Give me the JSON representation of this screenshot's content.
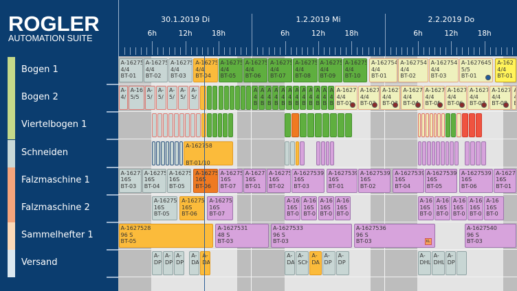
{
  "logo": {
    "name": "ROGLER",
    "subtitle": "AUTOMATION SUITE"
  },
  "timeline": {
    "days": [
      {
        "key": "30.1",
        "label": "30.1.2019 Di"
      },
      {
        "key": "1.2",
        "label": "1.2.2019 Mi"
      },
      {
        "key": "2.2",
        "label": "2.2.2019 Do"
      }
    ],
    "hour_labels": [
      {
        "h": 6,
        "label": "6h"
      },
      {
        "h": 12,
        "label": "12h"
      },
      {
        "h": 18,
        "label": "18h"
      }
    ],
    "current_time": "30.1 15:30"
  },
  "colors": {
    "grey": [
      "#c8d6d4",
      "#8fa3a3"
    ],
    "greyred": [
      "#c8d6d4",
      "#e07a72"
    ],
    "greyblue": [
      "#c8d6d4",
      "#2e5580"
    ],
    "orange": [
      "#fbbb3b",
      "#e39a1d"
    ],
    "dkorange": [
      "#ef7a22",
      "#c85a10"
    ],
    "green": [
      "#5faf3f",
      "#43902c"
    ],
    "ly": [
      "#eef1bd",
      "#e6a87c"
    ],
    "lyred": [
      "#f0edb8",
      "#e06f5f"
    ],
    "yellow": [
      "#fff45a",
      "#c9a21a"
    ],
    "purple": [
      "#d7a3dc",
      "#9d73ad"
    ],
    "red": [
      "#ef5340",
      "#d53a2a"
    ],
    "night": "#bdbdbd",
    "day": "#e4e4e4",
    "now_line": "#2b5d96"
  },
  "rows": [
    {
      "label": "Bogen 1",
      "stripe": "#c5d98a",
      "bars": [
        {
          "s": "30.1 0:00",
          "e": "30.1 4:30",
          "c": "grey",
          "t": [
            "A-16275",
            "4/4",
            "BT-01"
          ]
        },
        {
          "s": "30.1 4:30",
          "e": "30.1 9:00",
          "c": "grey",
          "t": [
            "A-16275",
            "4/4",
            "BT-02"
          ]
        },
        {
          "s": "30.1 9:00",
          "e": "30.1 13:30",
          "c": "grey",
          "t": [
            "A-16275",
            "4/4",
            "BT-03"
          ]
        },
        {
          "s": "30.1 13:30",
          "e": "30.1 18:00",
          "c": "orange",
          "t": [
            "A-16275",
            "4/4",
            "BT-04"
          ]
        },
        {
          "s": "30.1 18:00",
          "e": "30.1 22:30",
          "c": "green",
          "t": [
            "A-16275",
            "4/4",
            "BT-05"
          ]
        },
        {
          "s": "30.1 22:30",
          "e": "1.2 3:00",
          "c": "green",
          "t": [
            "A-16275",
            "4/4",
            "BT-06"
          ]
        },
        {
          "s": "1.2 3:00",
          "e": "1.2 7:30",
          "c": "green",
          "t": [
            "A-16275",
            "4/4",
            "BT-07"
          ]
        },
        {
          "s": "1.2 7:30",
          "e": "1.2 12:00",
          "c": "green",
          "t": [
            "A-16275",
            "4/4",
            "BT-08"
          ]
        },
        {
          "s": "1.2 12:00",
          "e": "1.2 16:30",
          "c": "green",
          "t": [
            "A-16275",
            "4/4",
            "BT-09"
          ]
        },
        {
          "s": "1.2 16:30",
          "e": "1.2 21:00",
          "c": "green",
          "t": [
            "A-16275",
            "4/4",
            "BT-10"
          ]
        },
        {
          "s": "1.2 21:15",
          "e": "2.2 2:30",
          "c": "ly",
          "t": [
            "A-1627541",
            "4/4",
            "BT-01"
          ]
        },
        {
          "s": "2.2 2:30",
          "e": "2.2 8:00",
          "c": "ly",
          "t": [
            "A-1627541",
            "4/4",
            "BT-02"
          ]
        },
        {
          "s": "2.2 8:00",
          "e": "2.2 13:30",
          "c": "ly",
          "t": [
            "A-1627541",
            "4/4",
            "BT-03"
          ]
        },
        {
          "s": "2.2 13:30",
          "e": "2.2 19:45",
          "c": "ly",
          "t": [
            "A-1627645",
            "5/5",
            "BT-01"
          ],
          "dot": "#1f5a9a"
        },
        {
          "s": "2.2 20:00",
          "e": "2.2 24:00",
          "c": "yellow",
          "t": [
            "A-162",
            "4/4",
            "BT-01"
          ]
        }
      ]
    },
    {
      "label": "Bogen 2",
      "stripe": "#c5d98a",
      "bars": [
        {
          "s": "30.1 0:00",
          "e": "30.1 1:45",
          "c": "greyred",
          "t": [
            "A-",
            "4/"
          ]
        },
        {
          "s": "30.1 1:45",
          "e": "30.1 4:45",
          "c": "greyred",
          "t": [
            "A-16",
            "5/5"
          ]
        },
        {
          "s": "30.1 4:45",
          "e": "30.1 6:45",
          "c": "greyred",
          "t": [
            "A-",
            "5/"
          ]
        },
        {
          "s": "30.1 6:45",
          "e": "30.1 8:45",
          "c": "greyred",
          "t": [
            "A-",
            "5/"
          ]
        },
        {
          "s": "30.1 8:45",
          "e": "30.1 10:45",
          "c": "greyred",
          "t": [
            "A-",
            "5/"
          ]
        },
        {
          "s": "30.1 10:45",
          "e": "30.1 12:45",
          "c": "greyred",
          "t": [
            "A-",
            "5/"
          ]
        },
        {
          "s": "30.1 12:45",
          "e": "30.1 14:45",
          "c": "greyred",
          "t": [
            "A-",
            "5/"
          ]
        },
        {
          "s": "30.1 14:45",
          "e": "30.1 16:00",
          "c": "orange",
          "n": 1
        },
        {
          "s": "30.1 16:00",
          "e": "30.1 24:00",
          "c": "green",
          "n": 8
        },
        {
          "s": "1.2 0:00",
          "e": "1.2 15:00",
          "c": "green",
          "n": 12,
          "t": [
            "A",
            "4",
            "B"
          ]
        },
        {
          "s": "1.2 15:00",
          "e": "1.2 19:15",
          "c": "ly",
          "t": [
            "A-1627",
            "4/4",
            "BT-01"
          ],
          "dot": "#8b2a2a"
        },
        {
          "s": "1.2 19:15",
          "e": "1.2 23:15",
          "c": "ly",
          "t": [
            "A-1627",
            "4/4",
            "BT-02"
          ],
          "dot": "#8b2a2a"
        },
        {
          "s": "1.2 23:15",
          "e": "2.2 3:00",
          "c": "ly",
          "t": [
            "A-1627",
            "4/4",
            "BT-03"
          ],
          "dot": "#8b2a2a"
        },
        {
          "s": "2.2 3:00",
          "e": "2.2 7:00",
          "c": "ly",
          "t": [
            "A-1627",
            "4/4",
            "BT-04"
          ],
          "dot": "#8b2a2a"
        },
        {
          "s": "2.2 7:00",
          "e": "2.2 11:00",
          "c": "ly",
          "t": [
            "A-1627",
            "4/4",
            "BT-05"
          ],
          "dot": "#8b2a2a"
        },
        {
          "s": "2.2 11:00",
          "e": "2.2 15:00",
          "c": "ly",
          "t": [
            "A-1627",
            "4/4",
            "BT-06"
          ],
          "dot": "#8b2a2a"
        },
        {
          "s": "2.2 15:00",
          "e": "2.2 19:00",
          "c": "ly",
          "t": [
            "A-1627",
            "4/4",
            "BT-07"
          ],
          "dot": "#8b2a2a"
        },
        {
          "s": "2.2 19:00",
          "e": "2.2 23:00",
          "c": "ly",
          "t": [
            "A-1627",
            "4/4",
            "BT-08"
          ],
          "dot": "#8b2a2a"
        },
        {
          "s": "2.2 23:00",
          "e": "2.2 24:00",
          "c": "ly",
          "t": [
            "A",
            "4",
            "B"
          ]
        }
      ]
    },
    {
      "label": "Viertelbogen 1",
      "stripe": "#c5d98a",
      "bars": [
        {
          "s": "30.1 6:00",
          "e": "30.1 15:00",
          "c": "greyred",
          "n": 9
        },
        {
          "s": "30.1 15:00",
          "e": "30.1 16:00",
          "c": "orange",
          "n": 1
        },
        {
          "s": "30.1 16:00",
          "e": "30.1 20:45",
          "c": "green",
          "n": 5
        },
        {
          "s": "1.2 6:00",
          "e": "1.2 7:15",
          "c": "green",
          "n": 1
        },
        {
          "s": "1.2 7:15",
          "e": "1.2 8:45",
          "c": "dkorange",
          "n": 1
        },
        {
          "s": "1.2 8:45",
          "e": "1.2 18:15",
          "c": "green",
          "n": 7
        },
        {
          "s": "2.2 6:00",
          "e": "2.2 11:00",
          "c": "lyred",
          "n": 7
        },
        {
          "s": "2.2 11:00",
          "e": "2.2 13:00",
          "c": "green",
          "n": 2
        },
        {
          "s": "2.2 13:00",
          "e": "2.2 14:00",
          "c": "lyred",
          "n": 1
        },
        {
          "s": "2.2 14:00",
          "e": "2.2 17:45",
          "c": "red",
          "n": 3
        }
      ]
    },
    {
      "label": "Schneiden",
      "stripe": "#c8d8d8",
      "bars": [
        {
          "s": "30.1 6:00",
          "e": "30.1 11:45",
          "c": "greyblue",
          "n": 7
        },
        {
          "s": "30.1 11:45",
          "e": "30.1 20:45",
          "c": "orange",
          "t": [
            "A-162758",
            "",
            "BT-01/10"
          ]
        },
        {
          "s": "1.2 6:00",
          "e": "1.2 8:00",
          "c": "grey",
          "n": 2
        },
        {
          "s": "1.2 8:00",
          "e": "1.2 8:45",
          "c": "orange",
          "n": 1
        },
        {
          "s": "1.2 8:45",
          "e": "1.2 9:45",
          "c": "purple",
          "n": 1
        },
        {
          "s": "1.2 11:45",
          "e": "1.2 15:00",
          "c": "purple",
          "n": 4
        },
        {
          "s": "2.2 6:00",
          "e": "2.2 13:30",
          "c": "purple",
          "n": 9
        },
        {
          "s": "2.2 14:30",
          "e": "2.2 18:30",
          "c": "purple",
          "n": 4
        }
      ]
    },
    {
      "label": "Falzmaschine 1",
      "stripe": "#f4a47c",
      "bars": [
        {
          "s": "30.1 0:00",
          "e": "30.1 4:15",
          "c": "grey",
          "t": [
            "A-16275",
            "16S",
            "BT-03"
          ]
        },
        {
          "s": "30.1 4:15",
          "e": "30.1 8:45",
          "c": "grey",
          "t": [
            "A-16275",
            "16S",
            "BT-04"
          ]
        },
        {
          "s": "30.1 8:45",
          "e": "30.1 13:15",
          "c": "grey",
          "t": [
            "A-16275",
            "16S",
            "BT-05"
          ]
        },
        {
          "s": "30.1 13:30",
          "e": "30.1 18:00",
          "c": "dkorange",
          "t": [
            "A-16275",
            "16S",
            "BT-06"
          ]
        },
        {
          "s": "30.1 18:00",
          "e": "30.1 22:30",
          "c": "purple",
          "t": [
            "A-16275",
            "16S",
            "BT-07"
          ]
        },
        {
          "s": "30.1 22:30",
          "e": "1.2 2:45",
          "c": "purple",
          "t": [
            "A-16275",
            "16S",
            "BT-01"
          ]
        },
        {
          "s": "1.2 2:45",
          "e": "1.2 7:15",
          "c": "purple",
          "t": [
            "A-16275",
            "16S",
            "BT-02"
          ]
        },
        {
          "s": "1.2 7:15",
          "e": "1.2 13:15",
          "c": "purple",
          "t": [
            "A-1627539",
            "16S",
            "BT-03"
          ]
        },
        {
          "s": "1.2 13:30",
          "e": "1.2 19:15",
          "c": "purple",
          "t": [
            "A-1627539",
            "16S",
            "BT-01"
          ]
        },
        {
          "s": "1.2 19:15",
          "e": "2.2 1:15",
          "c": "purple",
          "t": [
            "A-1627539",
            "16S",
            "BT-02"
          ]
        },
        {
          "s": "2.2 1:30",
          "e": "2.2 7:15",
          "c": "purple",
          "t": [
            "A-1627539",
            "16S",
            "BT-04"
          ]
        },
        {
          "s": "2.2 7:15",
          "e": "2.2 13:15",
          "c": "purple",
          "t": [
            "A-1627539",
            "16S",
            "BT-05"
          ]
        },
        {
          "s": "2.2 13:30",
          "e": "2.2 19:45",
          "c": "purple",
          "t": [
            "A-1627539",
            "16S",
            "BT-06"
          ]
        },
        {
          "s": "2.2 19:45",
          "e": "2.2 24:00",
          "c": "purple",
          "t": [
            "A-16275",
            "16S",
            "BT-01"
          ]
        }
      ]
    },
    {
      "label": "Falzmaschine 2",
      "stripe": "#f4a47c",
      "bars": [
        {
          "s": "30.1 6:00",
          "e": "30.1 10:45",
          "c": "grey",
          "t": [
            "A-162756",
            "16S",
            "BT-05"
          ]
        },
        {
          "s": "30.1 11:00",
          "e": "30.1 15:45",
          "c": "orange",
          "t": [
            "A-162756",
            "16S",
            "BT-06"
          ]
        },
        {
          "s": "30.1 16:00",
          "e": "30.1 20:45",
          "c": "purple",
          "t": [
            "A-162756",
            "16S",
            "BT-07"
          ]
        },
        {
          "s": "1.2 6:00",
          "e": "1.2 9:00",
          "c": "purple",
          "t": [
            "A-16",
            "16S",
            "BT-0"
          ]
        },
        {
          "s": "1.2 9:00",
          "e": "1.2 12:00",
          "c": "purple",
          "t": [
            "A-16",
            "16S",
            "BT-0"
          ]
        },
        {
          "s": "1.2 12:00",
          "e": "1.2 15:00",
          "c": "purple",
          "t": [
            "A-16",
            "16S",
            "BT-0"
          ]
        },
        {
          "s": "1.2 15:00",
          "e": "1.2 18:00",
          "c": "purple",
          "t": [
            "A-16",
            "16S",
            "BT-0"
          ]
        },
        {
          "s": "2.2 6:00",
          "e": "2.2 9:00",
          "c": "purple",
          "t": [
            "A-16",
            "16S",
            "BT-0"
          ]
        },
        {
          "s": "2.2 9:00",
          "e": "2.2 12:00",
          "c": "purple",
          "t": [
            "A-16",
            "16S",
            "BT-0"
          ]
        },
        {
          "s": "2.2 12:00",
          "e": "2.2 15:00",
          "c": "purple",
          "t": [
            "A-16",
            "16S",
            "BT-0"
          ]
        },
        {
          "s": "2.2 15:00",
          "e": "2.2 18:00",
          "c": "purple",
          "t": [
            "A-16",
            "16S",
            "BT-0"
          ]
        },
        {
          "s": "2.2 18:00",
          "e": "2.2 21:45",
          "c": "purple",
          "t": [
            "A-16",
            "16S",
            "BT-0"
          ]
        }
      ]
    },
    {
      "label": "Sammelhefter 1",
      "stripe": "#fcd9b8",
      "bars": [
        {
          "s": "30.1 0:00",
          "e": "30.1 17:15",
          "c": "orange",
          "t": [
            "A-1627528",
            "96 S",
            "BT-05"
          ]
        },
        {
          "s": "30.1 17:30",
          "e": "1.2 3:15",
          "c": "purple",
          "t": [
            "A-1627531",
            "48 S",
            "BT-03"
          ]
        },
        {
          "s": "1.2 3:30",
          "e": "1.2 18:15",
          "c": "purple",
          "t": [
            "A-1627533",
            "96 S",
            "BT-03"
          ]
        },
        {
          "s": "1.2 18:30",
          "e": "2.2 9:15",
          "c": "purple",
          "t": [
            "A-1627536",
            "96 S",
            "BT-03"
          ],
          "badge": "KL"
        },
        {
          "s": "2.2 14:30",
          "e": "2.2 24:00",
          "c": "purple",
          "t": [
            "A-1627540",
            "96 S",
            "BT-03"
          ]
        }
      ]
    },
    {
      "label": "Versand",
      "stripe": "#dce8f0",
      "bars": [
        {
          "s": "30.1 6:00",
          "e": "30.1 8:00",
          "c": "grey",
          "t": [
            "A-",
            "DP"
          ]
        },
        {
          "s": "30.1 8:00",
          "e": "30.1 10:00",
          "c": "grey",
          "t": [
            "A-",
            "DP"
          ]
        },
        {
          "s": "30.1 10:00",
          "e": "30.1 12:00",
          "c": "grey",
          "t": [
            "A-",
            "DP"
          ]
        },
        {
          "s": "30.1 12:45",
          "e": "30.1 14:45",
          "c": "grey",
          "t": [
            "A-",
            "DA"
          ]
        },
        {
          "s": "30.1 14:45",
          "e": "30.1 16:45",
          "c": "orange",
          "t": [
            "A-",
            "DA"
          ]
        },
        {
          "s": "1.2 6:00",
          "e": "1.2 8:00",
          "c": "grey",
          "t": [
            "A-",
            "DA"
          ]
        },
        {
          "s": "1.2 8:00",
          "e": "1.2 10:30",
          "c": "grey",
          "t": [
            "A-",
            "SCH"
          ]
        },
        {
          "s": "1.2 10:30",
          "e": "1.2 12:45",
          "c": "orange",
          "t": [
            "A-",
            "DA"
          ]
        },
        {
          "s": "1.2 12:45",
          "e": "1.2 15:15",
          "c": "grey",
          "t": [
            "A-",
            "DP"
          ]
        },
        {
          "s": "1.2 15:15",
          "e": "1.2 17:45",
          "c": "grey",
          "t": [
            "A-",
            "DP"
          ]
        },
        {
          "s": "2.2 6:00",
          "e": "2.2 8:30",
          "c": "grey",
          "t": [
            "A-",
            "DHL"
          ]
        },
        {
          "s": "2.2 8:30",
          "e": "2.2 11:00",
          "c": "grey",
          "t": [
            "A-",
            "DHL"
          ]
        },
        {
          "s": "2.2 11:00",
          "e": "2.2 13:00",
          "c": "grey",
          "t": [
            "A-",
            "DP"
          ]
        },
        {
          "s": "2.2 13:00",
          "e": "2.2 15:00",
          "c": "grey",
          "n": 1
        }
      ]
    }
  ]
}
